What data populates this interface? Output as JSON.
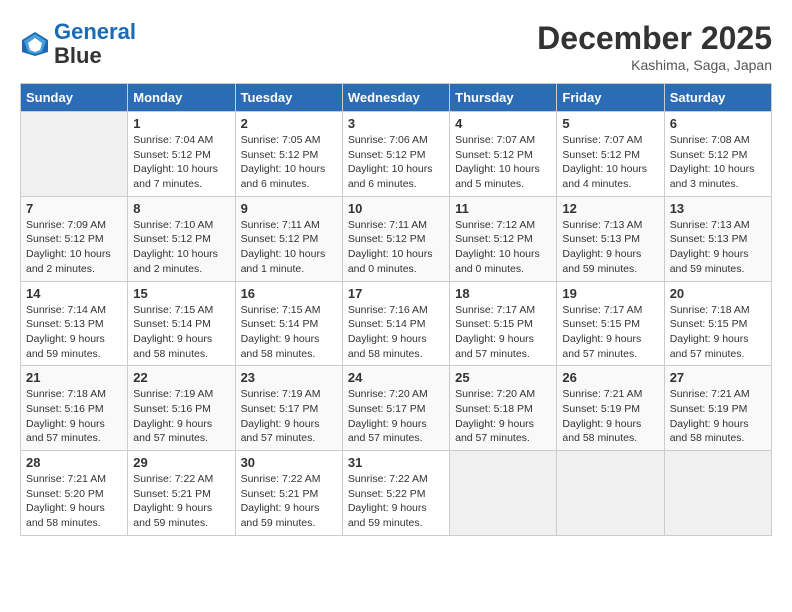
{
  "header": {
    "logo_line1": "General",
    "logo_line2": "Blue",
    "month": "December 2025",
    "location": "Kashima, Saga, Japan"
  },
  "weekdays": [
    "Sunday",
    "Monday",
    "Tuesday",
    "Wednesday",
    "Thursday",
    "Friday",
    "Saturday"
  ],
  "weeks": [
    [
      {
        "day": "",
        "info": ""
      },
      {
        "day": "1",
        "info": "Sunrise: 7:04 AM\nSunset: 5:12 PM\nDaylight: 10 hours\nand 7 minutes."
      },
      {
        "day": "2",
        "info": "Sunrise: 7:05 AM\nSunset: 5:12 PM\nDaylight: 10 hours\nand 6 minutes."
      },
      {
        "day": "3",
        "info": "Sunrise: 7:06 AM\nSunset: 5:12 PM\nDaylight: 10 hours\nand 6 minutes."
      },
      {
        "day": "4",
        "info": "Sunrise: 7:07 AM\nSunset: 5:12 PM\nDaylight: 10 hours\nand 5 minutes."
      },
      {
        "day": "5",
        "info": "Sunrise: 7:07 AM\nSunset: 5:12 PM\nDaylight: 10 hours\nand 4 minutes."
      },
      {
        "day": "6",
        "info": "Sunrise: 7:08 AM\nSunset: 5:12 PM\nDaylight: 10 hours\nand 3 minutes."
      }
    ],
    [
      {
        "day": "7",
        "info": "Sunrise: 7:09 AM\nSunset: 5:12 PM\nDaylight: 10 hours\nand 2 minutes."
      },
      {
        "day": "8",
        "info": "Sunrise: 7:10 AM\nSunset: 5:12 PM\nDaylight: 10 hours\nand 2 minutes."
      },
      {
        "day": "9",
        "info": "Sunrise: 7:11 AM\nSunset: 5:12 PM\nDaylight: 10 hours\nand 1 minute."
      },
      {
        "day": "10",
        "info": "Sunrise: 7:11 AM\nSunset: 5:12 PM\nDaylight: 10 hours\nand 0 minutes."
      },
      {
        "day": "11",
        "info": "Sunrise: 7:12 AM\nSunset: 5:12 PM\nDaylight: 10 hours\nand 0 minutes."
      },
      {
        "day": "12",
        "info": "Sunrise: 7:13 AM\nSunset: 5:13 PM\nDaylight: 9 hours\nand 59 minutes."
      },
      {
        "day": "13",
        "info": "Sunrise: 7:13 AM\nSunset: 5:13 PM\nDaylight: 9 hours\nand 59 minutes."
      }
    ],
    [
      {
        "day": "14",
        "info": "Sunrise: 7:14 AM\nSunset: 5:13 PM\nDaylight: 9 hours\nand 59 minutes."
      },
      {
        "day": "15",
        "info": "Sunrise: 7:15 AM\nSunset: 5:14 PM\nDaylight: 9 hours\nand 58 minutes."
      },
      {
        "day": "16",
        "info": "Sunrise: 7:15 AM\nSunset: 5:14 PM\nDaylight: 9 hours\nand 58 minutes."
      },
      {
        "day": "17",
        "info": "Sunrise: 7:16 AM\nSunset: 5:14 PM\nDaylight: 9 hours\nand 58 minutes."
      },
      {
        "day": "18",
        "info": "Sunrise: 7:17 AM\nSunset: 5:15 PM\nDaylight: 9 hours\nand 57 minutes."
      },
      {
        "day": "19",
        "info": "Sunrise: 7:17 AM\nSunset: 5:15 PM\nDaylight: 9 hours\nand 57 minutes."
      },
      {
        "day": "20",
        "info": "Sunrise: 7:18 AM\nSunset: 5:15 PM\nDaylight: 9 hours\nand 57 minutes."
      }
    ],
    [
      {
        "day": "21",
        "info": "Sunrise: 7:18 AM\nSunset: 5:16 PM\nDaylight: 9 hours\nand 57 minutes."
      },
      {
        "day": "22",
        "info": "Sunrise: 7:19 AM\nSunset: 5:16 PM\nDaylight: 9 hours\nand 57 minutes."
      },
      {
        "day": "23",
        "info": "Sunrise: 7:19 AM\nSunset: 5:17 PM\nDaylight: 9 hours\nand 57 minutes."
      },
      {
        "day": "24",
        "info": "Sunrise: 7:20 AM\nSunset: 5:17 PM\nDaylight: 9 hours\nand 57 minutes."
      },
      {
        "day": "25",
        "info": "Sunrise: 7:20 AM\nSunset: 5:18 PM\nDaylight: 9 hours\nand 57 minutes."
      },
      {
        "day": "26",
        "info": "Sunrise: 7:21 AM\nSunset: 5:19 PM\nDaylight: 9 hours\nand 58 minutes."
      },
      {
        "day": "27",
        "info": "Sunrise: 7:21 AM\nSunset: 5:19 PM\nDaylight: 9 hours\nand 58 minutes."
      }
    ],
    [
      {
        "day": "28",
        "info": "Sunrise: 7:21 AM\nSunset: 5:20 PM\nDaylight: 9 hours\nand 58 minutes."
      },
      {
        "day": "29",
        "info": "Sunrise: 7:22 AM\nSunset: 5:21 PM\nDaylight: 9 hours\nand 59 minutes."
      },
      {
        "day": "30",
        "info": "Sunrise: 7:22 AM\nSunset: 5:21 PM\nDaylight: 9 hours\nand 59 minutes."
      },
      {
        "day": "31",
        "info": "Sunrise: 7:22 AM\nSunset: 5:22 PM\nDaylight: 9 hours\nand 59 minutes."
      },
      {
        "day": "",
        "info": ""
      },
      {
        "day": "",
        "info": ""
      },
      {
        "day": "",
        "info": ""
      }
    ]
  ]
}
